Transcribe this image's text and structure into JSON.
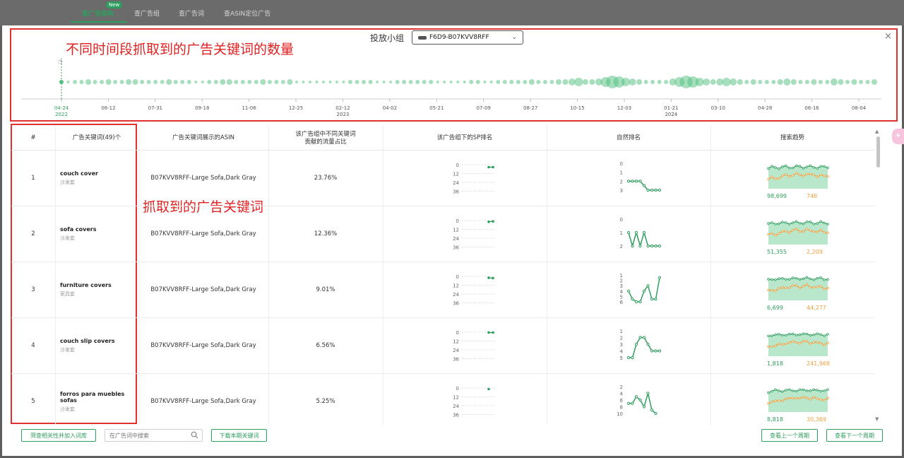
{
  "top_nav": {
    "tabs": [
      {
        "label": "查广告架构",
        "active": true
      },
      {
        "label": "查广告组",
        "active": false
      },
      {
        "label": "查广告词",
        "active": false
      },
      {
        "label": "查ASIN定位广告",
        "active": false
      }
    ],
    "new_badge": "New"
  },
  "dialog": {
    "close_icon": "×",
    "group_label": "投放小组",
    "group_select_value": "F6D9-B07KVV8RFF",
    "chevron_icon": "chevron-down-icon"
  },
  "annotations": {
    "timeline_note": "不同时间段抓取到的广告关键词的数量",
    "keyword_note": "抓取到的广告关键词"
  },
  "timeline": {
    "ticks": [
      {
        "date": "04-24",
        "year": "2022",
        "highlight": true
      },
      {
        "date": "06-12",
        "year": ""
      },
      {
        "date": "07-31",
        "year": ""
      },
      {
        "date": "09-18",
        "year": ""
      },
      {
        "date": "11-06",
        "year": ""
      },
      {
        "date": "12-25",
        "year": ""
      },
      {
        "date": "02-12",
        "year": "2023"
      },
      {
        "date": "04-02",
        "year": ""
      },
      {
        "date": "05-21",
        "year": ""
      },
      {
        "date": "07-09",
        "year": ""
      },
      {
        "date": "08-27",
        "year": ""
      },
      {
        "date": "10-15",
        "year": ""
      },
      {
        "date": "12-03",
        "year": ""
      },
      {
        "date": "01-21",
        "year": "2024"
      },
      {
        "date": "03-10",
        "year": ""
      },
      {
        "date": "04-28",
        "year": ""
      },
      {
        "date": "06-16",
        "year": ""
      },
      {
        "date": "08-04",
        "year": ""
      }
    ],
    "bubble_sizes": [
      3,
      2,
      3,
      3,
      4,
      3,
      3,
      4,
      3,
      3,
      4,
      4,
      3,
      3,
      3,
      3,
      4,
      3,
      3,
      3,
      2,
      2,
      3,
      3,
      4,
      4,
      3,
      3,
      3,
      3,
      4,
      3,
      3,
      3,
      4,
      2,
      2,
      2,
      2,
      2,
      2,
      2,
      2,
      3,
      3,
      3,
      3,
      2,
      2,
      2,
      3,
      3,
      3,
      3,
      3,
      3,
      2,
      2,
      2,
      2,
      2,
      3,
      3,
      2,
      2,
      3,
      3,
      3,
      3,
      3,
      4,
      3,
      3,
      3,
      4,
      4,
      5,
      6,
      4,
      4,
      5,
      7,
      9,
      8,
      6,
      5,
      4,
      3,
      3,
      3,
      3,
      5,
      7,
      9,
      8,
      6,
      5,
      4,
      5,
      6,
      5,
      4,
      3,
      4,
      3,
      3,
      3,
      4,
      5,
      4,
      3,
      3,
      4,
      3,
      3,
      5,
      4,
      3,
      4,
      3,
      3,
      4
    ]
  },
  "table": {
    "headers": {
      "index": "#",
      "keyword": "广告关键词(49)个",
      "asin": "广告关键词展示的ASIN",
      "traffic_share": "该广告组中不同关键词\n贡献的流量占比",
      "sp_rank": "该广告组下的SP排名",
      "organic_rank": "自然排名",
      "search_trend": "搜索趋势"
    },
    "rows": [
      {
        "index": "1",
        "keyword": "couch cover",
        "keyword_sub": "沙发套",
        "asin": "B07KVV8RFF-Large Sofa,Dark Gray",
        "share": "23.76%",
        "sp_ticks": [
          "0",
          "12",
          "24",
          "36"
        ],
        "sp_points": [
          3.5,
          3.5
        ],
        "org_ticks": [
          "0",
          "1",
          "2",
          "3"
        ],
        "org_points": [
          2,
          2,
          2,
          2,
          2.5,
          3,
          3,
          3,
          3
        ],
        "trend_left": "98,699",
        "trend_right": "746"
      },
      {
        "index": "2",
        "keyword": "sofa covers",
        "keyword_sub": "沙发套",
        "asin": "B07KVV8RFF-Large Sofa,Dark Gray",
        "share": "12.36%",
        "sp_ticks": [
          "0",
          "12",
          "24",
          "36"
        ],
        "sp_points": [
          1.8,
          1.2
        ],
        "org_ticks": [
          "0",
          "1",
          "2"
        ],
        "org_points": [
          1,
          2,
          1,
          2,
          1,
          2,
          2,
          2,
          2
        ],
        "trend_left": "51,355",
        "trend_right": "2,209"
      },
      {
        "index": "3",
        "keyword": "furniture covers",
        "keyword_sub": "家具套",
        "asin": "B07KVV8RFF-Large Sofa,Dark Gray",
        "share": "9.01%",
        "sp_ticks": [
          "0",
          "12",
          "24",
          "36"
        ],
        "sp_points": [
          2,
          2.5
        ],
        "org_ticks": [
          "1",
          "2",
          "3",
          "4",
          "5",
          "6"
        ],
        "org_points": [
          4,
          5.5,
          6,
          6,
          4,
          3,
          5.5,
          5.5,
          1.5
        ],
        "trend_left": "6,699",
        "trend_right": "44,277"
      },
      {
        "index": "4",
        "keyword": "couch slip covers",
        "keyword_sub": "沙发套",
        "asin": "B07KVV8RFF-Large Sofa,Dark Gray",
        "share": "6.56%",
        "sp_ticks": [
          "0",
          "12",
          "24",
          "36"
        ],
        "sp_points": [
          0.5,
          0.5
        ],
        "org_ticks": [
          "1",
          "2",
          "3",
          "4",
          "5"
        ],
        "org_points": [
          5,
          5,
          3,
          2,
          2,
          3,
          4,
          4,
          4
        ],
        "trend_left": "1,818",
        "trend_right": "241,968"
      },
      {
        "index": "5",
        "keyword": "forros para muebles sofas",
        "keyword_sub": "沙发套",
        "asin": "B07KVV8RFF-Large Sofa,Dark Gray",
        "share": "5.25%",
        "sp_ticks": [
          "0",
          "12",
          "24",
          "36"
        ],
        "sp_points": [
          1.5
        ],
        "org_ticks": [
          "2",
          "4",
          "6",
          "8",
          "10"
        ],
        "org_points": [
          7,
          7,
          5,
          6,
          8,
          4,
          9,
          10
        ],
        "trend_left": "8,818",
        "trend_right": "30,369"
      }
    ],
    "trend_green": [
      0.75,
      0.8,
      0.8,
      0.78,
      0.8,
      0.82,
      0.8,
      0.8,
      0.82,
      0.82,
      0.8,
      0.82,
      0.82,
      0.8,
      0.8,
      0.82,
      0.8,
      0.8
    ],
    "trend_orange": [
      0.35,
      0.4,
      0.38,
      0.42,
      0.45,
      0.5,
      0.48,
      0.52,
      0.55,
      0.5,
      0.52,
      0.55,
      0.5,
      0.52,
      0.48,
      0.5,
      0.45,
      0.48
    ]
  },
  "footer": {
    "filter_button": "筛查相关性并加入词库",
    "search_placeholder": "在广告词中搜索",
    "download_button": "下载本期关键词",
    "prev_button": "查看上一个周期",
    "next_button": "查看下一个周期"
  },
  "colors": {
    "accent_green": "#2e9e5e",
    "bubble_green": "#4fc07e",
    "trend_orange": "#f0a040",
    "annotation_red": "#e03030"
  }
}
